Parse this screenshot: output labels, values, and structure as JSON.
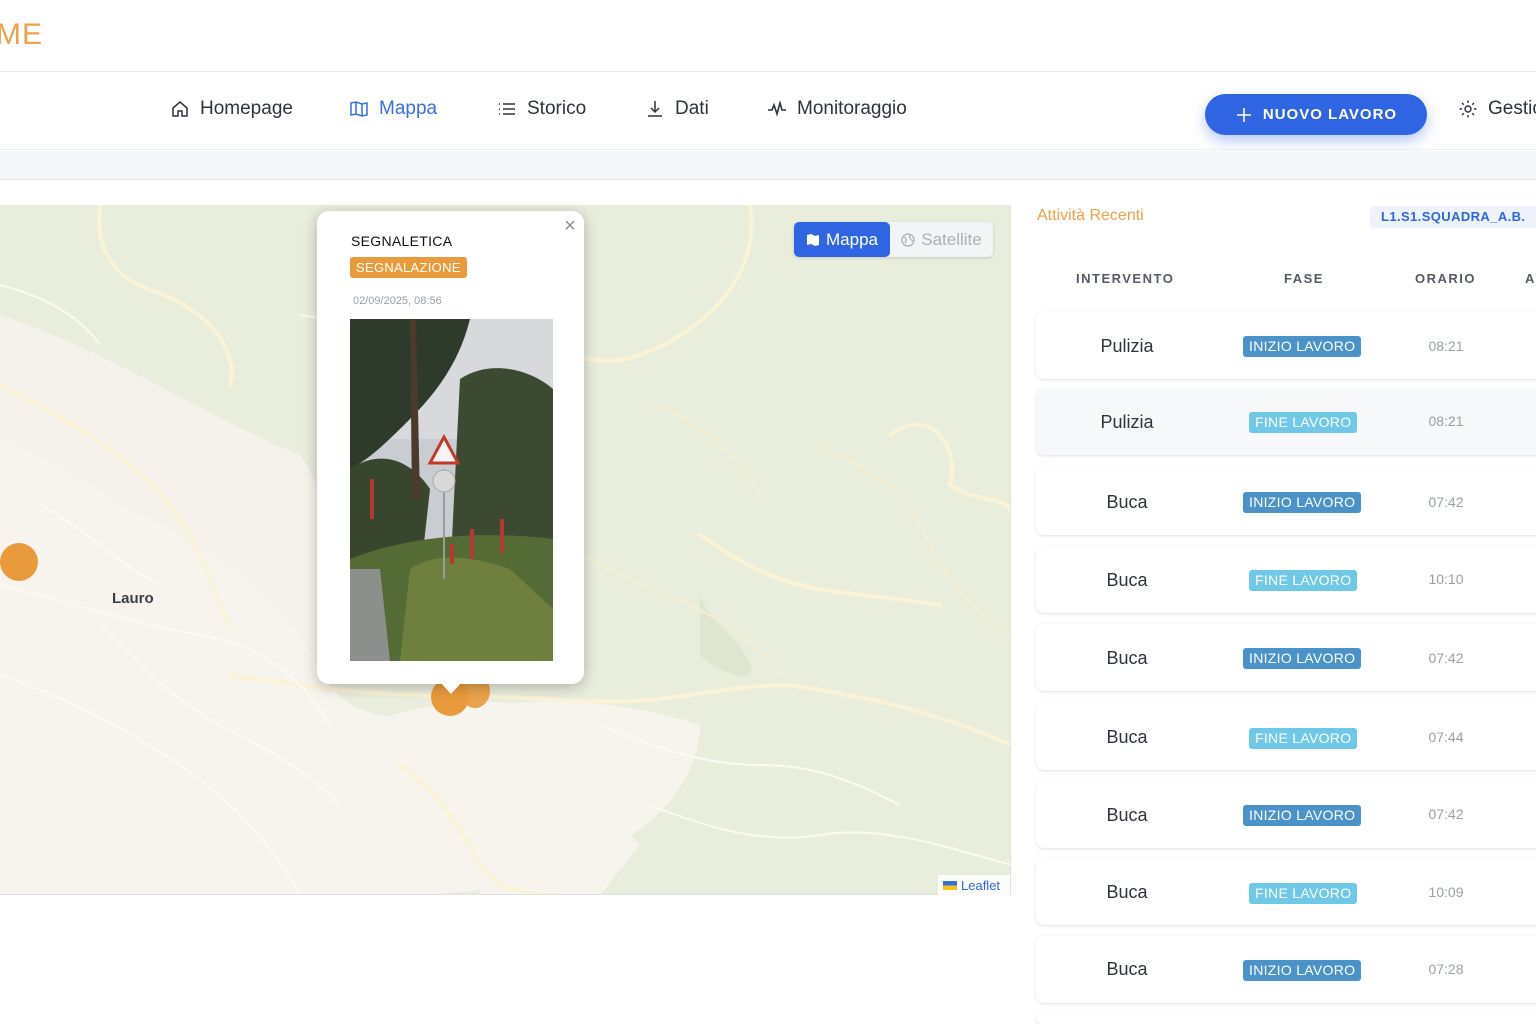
{
  "brand": {
    "logo_text": "ME",
    "accent_color": "#f0a04a",
    "primary_color": "#2f65e2"
  },
  "nav": {
    "items": [
      {
        "label": "Homepage",
        "icon": "home-icon"
      },
      {
        "label": "Mappa",
        "icon": "map-icon",
        "active": true
      },
      {
        "label": "Storico",
        "icon": "list-icon"
      },
      {
        "label": "Dati",
        "icon": "download-icon"
      },
      {
        "label": "Monitoraggio",
        "icon": "pulse-icon"
      }
    ],
    "new_job_label": "NUOVO LAVORO",
    "settings_label": "Gestic"
  },
  "map": {
    "place_label": "Lauro",
    "toggle": {
      "map_label": "Mappa",
      "satellite_label": "Satellite"
    },
    "attribution": "Leaflet",
    "popup": {
      "title": "SEGNALETICA",
      "badge": "SEGNALAZIONE",
      "date": "02/09/2025, 08:56",
      "close": "×"
    }
  },
  "panel": {
    "title": "Attività Recenti",
    "team": "L1.S1.SQUADRA_A.B.",
    "headers": [
      "INTERVENTO",
      "FASE",
      "ORARIO",
      "A"
    ],
    "rows": [
      {
        "intervento": "Pulizia",
        "fase": "INIZIO LAVORO",
        "orario": "08:21"
      },
      {
        "intervento": "Pulizia",
        "fase": "FINE LAVORO",
        "orario": "08:21"
      },
      {
        "intervento": "Buca",
        "fase": "INIZIO LAVORO",
        "orario": "07:42"
      },
      {
        "intervento": "Buca",
        "fase": "FINE LAVORO",
        "orario": "10:10"
      },
      {
        "intervento": "Buca",
        "fase": "INIZIO LAVORO",
        "orario": "07:42"
      },
      {
        "intervento": "Buca",
        "fase": "FINE LAVORO",
        "orario": "07:44"
      },
      {
        "intervento": "Buca",
        "fase": "INIZIO LAVORO",
        "orario": "07:42"
      },
      {
        "intervento": "Buca",
        "fase": "FINE LAVORO",
        "orario": "10:09"
      },
      {
        "intervento": "Buca",
        "fase": "INIZIO LAVORO",
        "orario": "07:28"
      }
    ]
  }
}
